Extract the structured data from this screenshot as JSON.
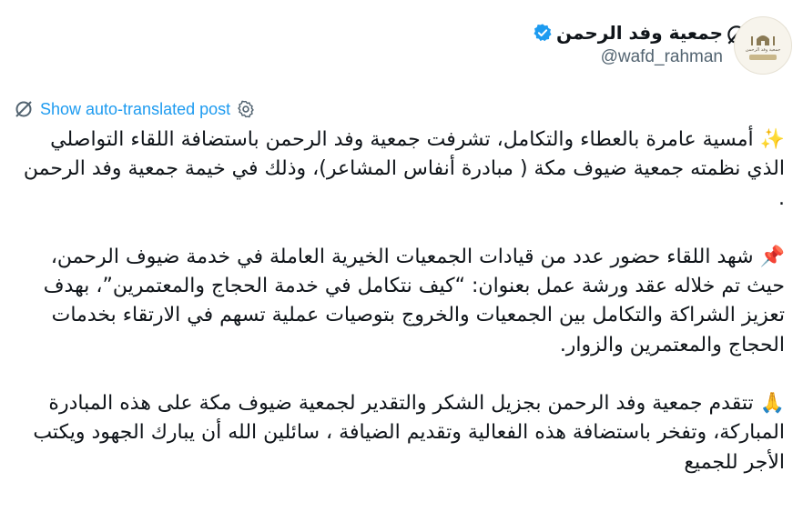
{
  "post": {
    "author": {
      "display_name": "جمعية وفد الرحمن",
      "handle": "@wafd_rahman",
      "verified": true,
      "avatar_text": "جمعية وفد الرحمن"
    },
    "translate_label": "Show auto-translated post",
    "paragraphs": [
      {
        "emoji": "✨",
        "text": " أمسية عامرة بالعطاء والتكامل، تشرفت جمعية وفد الرحمن باستضافة اللقاء التواصلي الذي نظمته جمعية ضيوف مكة ( مبادرة أنفاس المشاعر)، وذلك في خيمة جمعية وفد الرحمن ."
      },
      {
        "emoji": "📌",
        "text": " شهد اللقاء حضور عدد من قيادات الجمعيات الخيرية العاملة في خدمة ضيوف الرحمن، حيث تم خلاله عقد ورشة عمل بعنوان: “كيف نتكامل في خدمة الحجاج والمعتمرين”، بهدف تعزيز الشراكة والتكامل بين الجمعيات والخروج بتوصيات عملية تسهم في الارتقاء بخدمات الحجاج والمعتمرين والزوار."
      },
      {
        "emoji": "🙏",
        "text": " تتقدم جمعية وفد الرحمن بجزيل الشكر والتقدير لجمعية ضيوف مكة على هذه المبادرة المباركة، وتفخر باستضافة هذه الفعالية وتقديم الضيافة ، سائلين الله أن يبارك الجهود ويكتب الأجر للجميع"
      }
    ]
  },
  "colors": {
    "accent": "#1d9bf0",
    "text": "#0f1419",
    "muted": "#536471"
  },
  "icons": {
    "grok": "grok-icon",
    "more": "more-icon",
    "verified": "verified-badge-icon",
    "translate": "translate-icon",
    "settings": "gear-icon"
  }
}
